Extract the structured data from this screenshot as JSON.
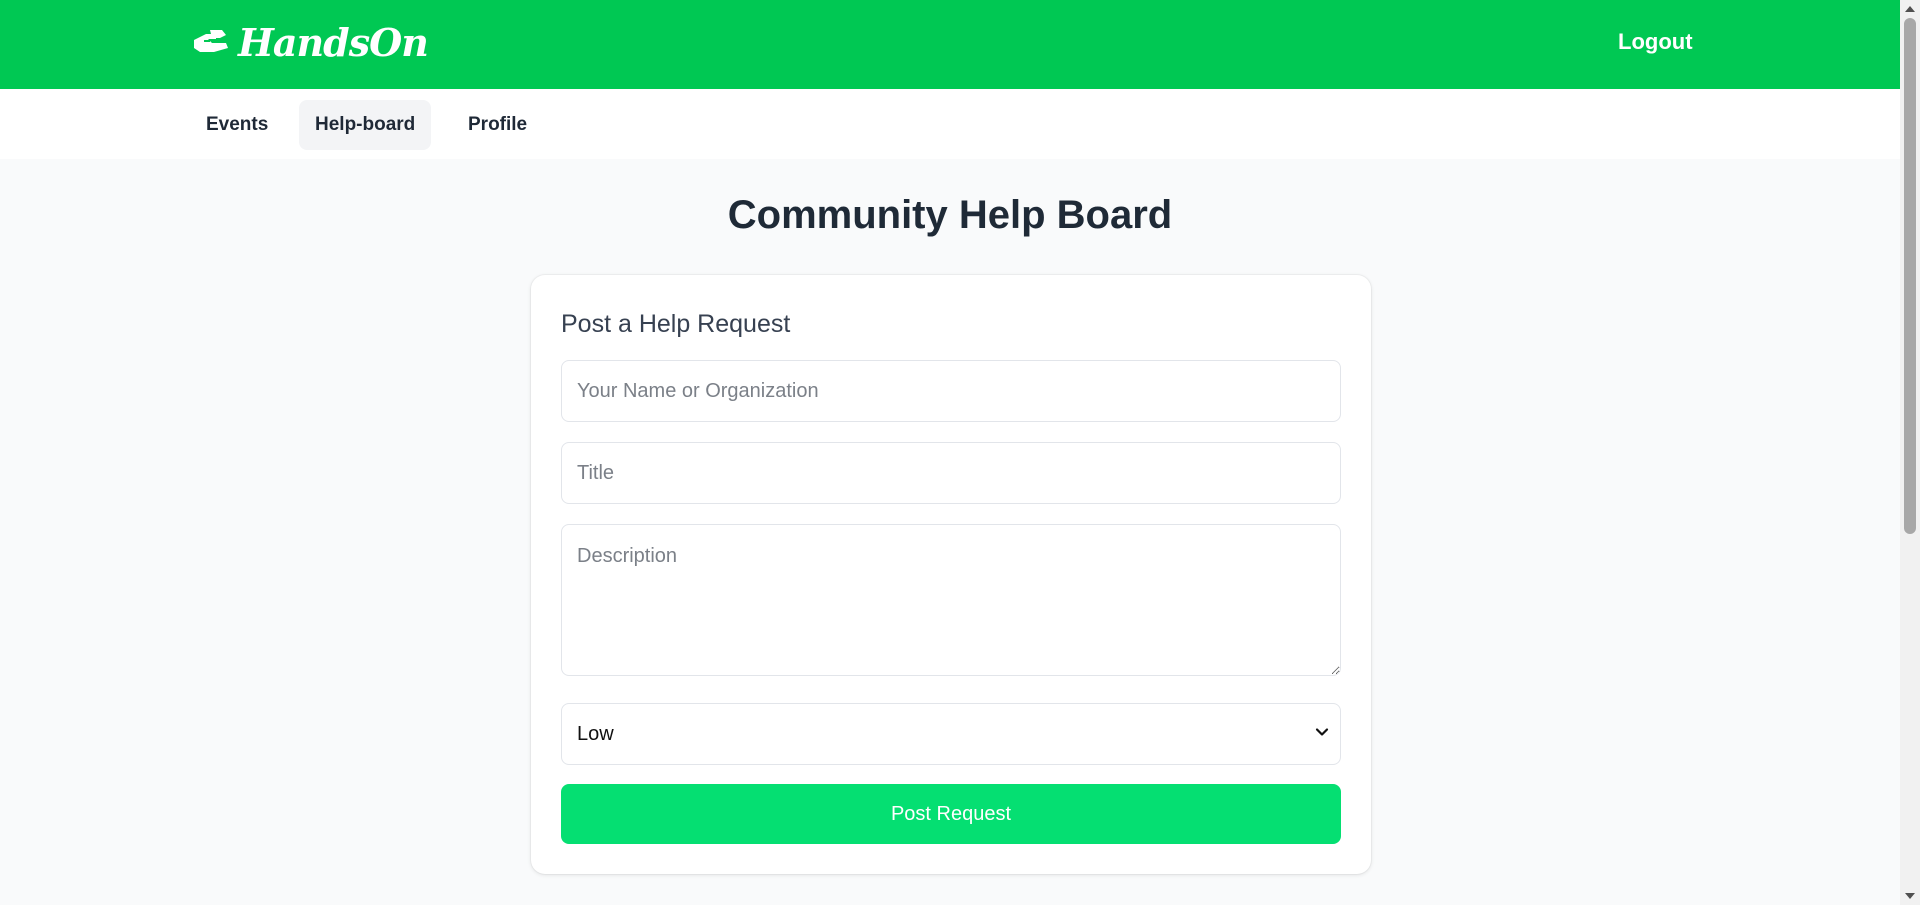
{
  "header": {
    "brand_name": "HandsOn",
    "brand_icon": "helping-hands-icon",
    "logout_label": "Logout",
    "background_color": "#00c853"
  },
  "nav": {
    "items": [
      {
        "label": "Events",
        "active": false
      },
      {
        "label": "Help-board",
        "active": true
      },
      {
        "label": "Profile",
        "active": false
      }
    ]
  },
  "main": {
    "title": "Community Help Board"
  },
  "form": {
    "title": "Post a Help Request",
    "name_placeholder": "Your Name or Organization",
    "name_value": "",
    "title_placeholder": "Title",
    "title_value": "",
    "description_placeholder": "Description",
    "description_value": "",
    "priority": {
      "selected": "Low",
      "options": [
        "Low"
      ]
    },
    "submit_label": "Post Request",
    "accent_color": "#05df72"
  }
}
